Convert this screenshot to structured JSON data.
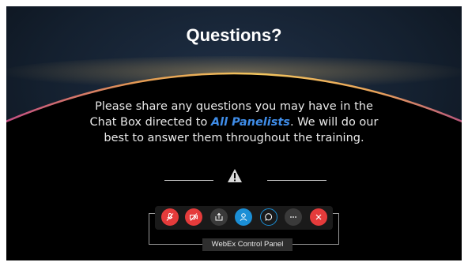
{
  "slide": {
    "title": "Questions?",
    "body_before": "Please share any questions you may have in the Chat Box directed to ",
    "body_highlight": "All Panelists",
    "body_after": ". We will do our best to answer them throughout the training."
  },
  "control_panel": {
    "label": "WebEx Control Panel",
    "buttons": [
      {
        "name": "mute-button",
        "icon": "mic-off-icon",
        "color": "#e53b3b"
      },
      {
        "name": "video-button",
        "icon": "video-off-icon",
        "color": "#e53b3b"
      },
      {
        "name": "share-button",
        "icon": "share-icon",
        "color": "#3a3a3a"
      },
      {
        "name": "participants-button",
        "icon": "participants-icon",
        "color": "#1b8fd6"
      },
      {
        "name": "chat-button",
        "icon": "chat-icon",
        "color": "#1b8fd6"
      },
      {
        "name": "more-button",
        "icon": "more-icon",
        "color": "#3a3a3a"
      },
      {
        "name": "leave-button",
        "icon": "close-icon",
        "color": "#e53b3b"
      }
    ]
  },
  "colors": {
    "highlight": "#3f8de9",
    "accent_red": "#e53b3b",
    "accent_blue": "#1b8fd6"
  }
}
